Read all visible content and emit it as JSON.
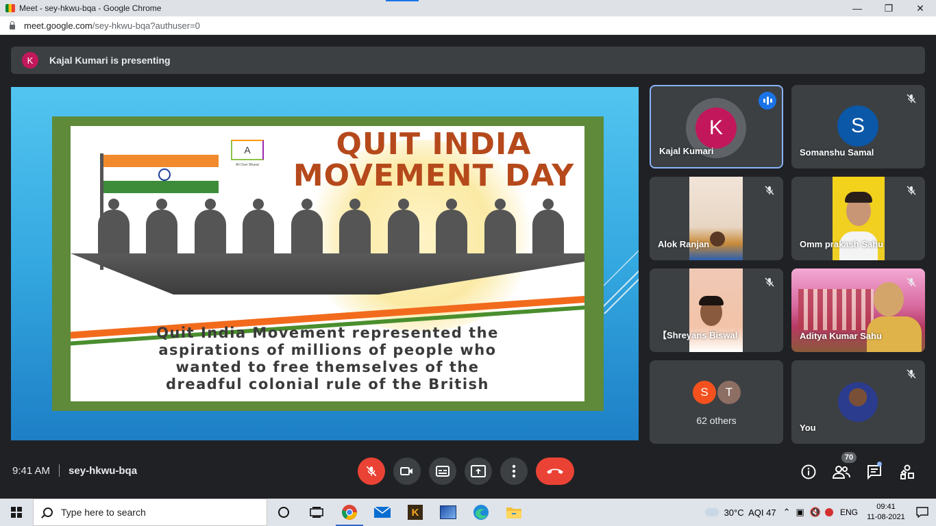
{
  "window": {
    "title": "Meet - sey-hkwu-bqa - Google Chrome",
    "url_host": "meet.google.com",
    "url_path": "/sey-hkwu-bqa?authuser=0"
  },
  "presenting_bar": {
    "avatar_letter": "K",
    "text": "Kajal Kumari is presenting"
  },
  "slide": {
    "heading_line1": "QUIT INDIA",
    "heading_line2": "MOVEMENT DAY",
    "logo_letter": "A",
    "logo_subtitle": "All Over Bharat",
    "quote": [
      "Quit India Movement represented the",
      "aspirations of millions of people who",
      "wanted to free themselves of the",
      "dreadful colonial rule of the British"
    ]
  },
  "participants": [
    {
      "name": "Kajal Kumari",
      "avatar_letter": "K",
      "avatar_color": "#c2185b",
      "state": "speaking"
    },
    {
      "name": "Somanshu Samal",
      "avatar_letter": "S",
      "avatar_color": "#0b57a8",
      "state": "muted"
    },
    {
      "name": "Alok Ranjan",
      "state": "muted"
    },
    {
      "name": "Omm prakash Sahu",
      "state": "muted"
    },
    {
      "name": "【Shreyans Biswal",
      "state": "muted"
    },
    {
      "name": "Aditya Kumar Sahu",
      "state": "muted"
    },
    {
      "name": "You",
      "state": "muted"
    }
  ],
  "others_tile": {
    "avatars": [
      {
        "letter": "S",
        "color": "#f4511e"
      },
      {
        "letter": "T",
        "color": "#8d6e63"
      }
    ],
    "label": "62 others"
  },
  "bottom_bar": {
    "time": "9:41 AM",
    "meeting_code": "sey-hkwu-bqa",
    "participant_count": "70",
    "colors": {
      "danger": "#ea4335",
      "control": "#3c4043"
    }
  },
  "taskbar": {
    "search_placeholder": "Type here to search",
    "weather": "30°C  AQI 47",
    "language": "ENG",
    "clock_time": "09:41",
    "clock_date": "11-08-2021"
  }
}
